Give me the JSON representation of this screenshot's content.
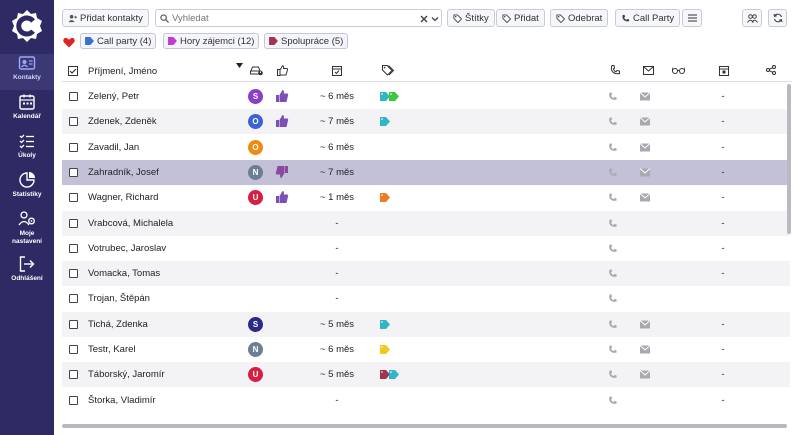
{
  "toolbar": {
    "add_contacts": "Přidat kontakty",
    "search_placeholder": "Vyhledat",
    "tags_button": "Štítky",
    "add_button": "Přidat",
    "remove_button": "Odebrat",
    "call_party_button": "Call Party"
  },
  "filters": [
    {
      "label": "Call party (4)",
      "color": "#3b6fd8"
    },
    {
      "label": "Hory zájemci (12)",
      "color": "#c13bd1"
    },
    {
      "label": "Spolupráce (5)",
      "color": "#a3334f"
    }
  ],
  "sidebar": {
    "items": [
      {
        "label": "Kontakty",
        "icon": "contacts-icon"
      },
      {
        "label": "Kalendář",
        "icon": "calendar-icon"
      },
      {
        "label": "Úkoly",
        "icon": "tasks-icon"
      },
      {
        "label": "Statistiky",
        "icon": "stats-icon"
      },
      {
        "label": "Moje nastavení",
        "icon": "settings-icon"
      },
      {
        "label": "Odhlášení",
        "icon": "logout-icon"
      }
    ]
  },
  "table": {
    "header_name": "Příjmení, Jméno",
    "rows": [
      {
        "name": "Zelený, Petr",
        "avatar": "S",
        "avatar_color": "#8a3fc8",
        "thumb": "up",
        "value": "~ 6 měs",
        "tags": [
          "#2fb7c9",
          "#3bc83b"
        ],
        "dash": "-"
      },
      {
        "name": "Zdenek, Zdeněk",
        "avatar": "O",
        "avatar_color": "#3b63d6",
        "thumb": "up",
        "value": "~ 7 měs",
        "tags": [
          "#2fb7c9"
        ],
        "dash": "-"
      },
      {
        "name": "Zavadil, Jan",
        "avatar": "O",
        "avatar_color": "#ef8a12",
        "thumb": "",
        "value": "~ 6 měs",
        "tags": [],
        "dash": "-"
      },
      {
        "name": "Zahradník, Josef",
        "avatar": "N",
        "avatar_color": "#6e7e96",
        "thumb": "down",
        "value": "~ 7 měs",
        "tags": [],
        "dash": "-"
      },
      {
        "name": "Wagner, Richard",
        "avatar": "U",
        "avatar_color": "#d71f43",
        "thumb": "up",
        "value": "~ 1 měs",
        "tags": [
          "#ef7a22"
        ],
        "dash": "-"
      },
      {
        "name": "Vrabcová, Michalela",
        "avatar": "",
        "avatar_color": "",
        "thumb": "",
        "value": "-",
        "tags": [],
        "dash": "-"
      },
      {
        "name": "Votrubec, Jaroslav",
        "avatar": "",
        "avatar_color": "",
        "thumb": "",
        "value": "-",
        "tags": [],
        "dash": "-"
      },
      {
        "name": "Vomacka, Tomas",
        "avatar": "",
        "avatar_color": "",
        "thumb": "",
        "value": "-",
        "tags": [],
        "dash": "-"
      },
      {
        "name": "Trojan, Štěpán",
        "avatar": "",
        "avatar_color": "",
        "thumb": "",
        "value": "-",
        "tags": [],
        "dash": ""
      },
      {
        "name": "Tichá, Zdenka",
        "avatar": "S",
        "avatar_color": "#2b2a8a",
        "thumb": "",
        "value": "~ 5 měs",
        "tags": [
          "#2fb7c9"
        ],
        "dash": "-"
      },
      {
        "name": "Testr, Karel",
        "avatar": "N",
        "avatar_color": "#6e7e96",
        "thumb": "",
        "value": "~ 6 měs",
        "tags": [
          "#f0c91c"
        ],
        "dash": "-"
      },
      {
        "name": "Táborský, Jaromír",
        "avatar": "U",
        "avatar_color": "#d71f43",
        "thumb": "",
        "value": "~ 5 měs",
        "tags": [
          "#a3334f",
          "#2fb7c9"
        ],
        "dash": "-"
      },
      {
        "name": "Štorka, Vladimír",
        "avatar": "",
        "avatar_color": "",
        "thumb": "",
        "value": "-",
        "tags": [],
        "dash": "-"
      }
    ]
  }
}
